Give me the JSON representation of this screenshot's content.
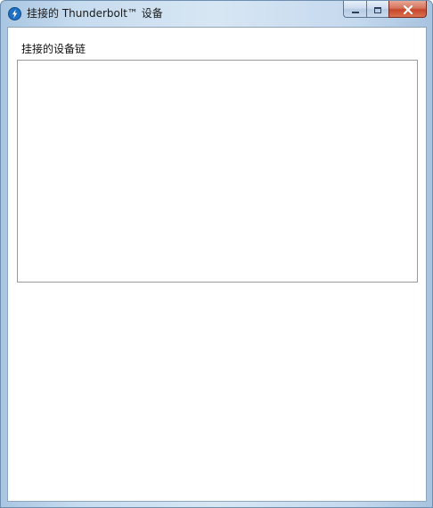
{
  "window": {
    "title": "挂接的 Thunderbolt™ 设备",
    "app_icon": "thunderbolt-icon"
  },
  "caption_buttons": {
    "minimize": "minimize-icon",
    "maximize": "maximize-icon",
    "close": "close-icon"
  },
  "main": {
    "chain_label": "挂接的设备链",
    "chain_items": []
  },
  "colors": {
    "frame": "#c7dcef",
    "close_button": "#c7462a"
  }
}
